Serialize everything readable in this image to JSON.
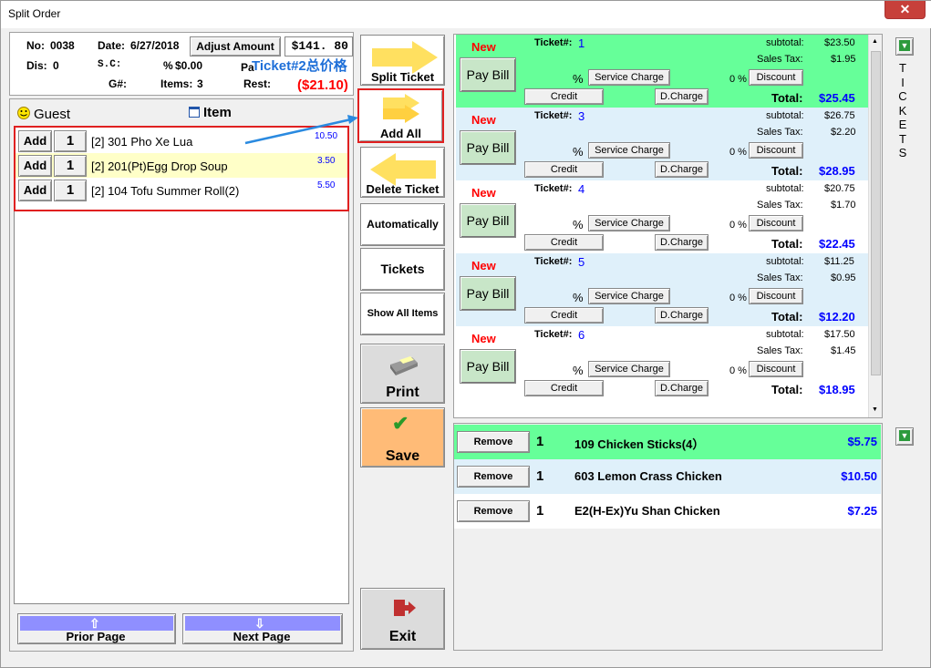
{
  "window": {
    "title": "Split Order",
    "close": "✕"
  },
  "order": {
    "no_label": "No:",
    "no": "0038",
    "date_label": "Date:",
    "date": "6/27/2018",
    "adjust_label": "Adjust Amount",
    "amount": "$141. 80",
    "dis_label": "Dis:",
    "dis": "0",
    "sc_label": "S.C:",
    "pct_label": "%",
    "sc_value": "$0.00",
    "paid_label": "Pa",
    "g_label": "G#:",
    "items_label": "Items:",
    "items": "3",
    "rest_label": "Rest:",
    "rest": "($21.10)"
  },
  "annotation": {
    "text": "Ticket#2总价格"
  },
  "tabs": {
    "guest": "Guest",
    "item": "Item"
  },
  "guest_items": [
    {
      "add": "Add",
      "qty": "1",
      "name": "[2] 301 Pho Xe Lua",
      "price": "10.50",
      "bg": "#ffffff"
    },
    {
      "add": "Add",
      "qty": "1",
      "name": "[2] 201(Pt)Egg Drop Soup",
      "price": "3.50",
      "bg": "#ffffc8"
    },
    {
      "add": "Add",
      "qty": "1",
      "name": "[2] 104 Tofu Summer Roll(2)",
      "price": "5.50",
      "bg": "#ffffff"
    }
  ],
  "pager": {
    "prior": "Prior Page",
    "next": "Next Page"
  },
  "actions": {
    "split_ticket": "Split Ticket",
    "add_all": "Add All",
    "delete_ticket": "Delete Ticket",
    "automatically": "Automatically",
    "tickets": "Tickets",
    "show_all": "Show All Items",
    "print": "Print",
    "save": "Save",
    "exit": "Exit"
  },
  "ticket_labels": {
    "new": "New",
    "ticket": "Ticket#:",
    "subtotal": "subtotal:",
    "tax": "Sales Tax:",
    "pay_bill": "Pay Bill",
    "pct": "%",
    "service_charge": "Service Charge",
    "zero_pct": "0 %",
    "discount": "Discount",
    "credit": "Credit",
    "dcharge": "D.Charge",
    "total": "Total:"
  },
  "tickets": [
    {
      "num": "1",
      "subtotal": "$23.50",
      "tax": "$1.95",
      "total": "$25.45",
      "bg": "#66ff99"
    },
    {
      "num": "3",
      "subtotal": "$26.75",
      "tax": "$2.20",
      "total": "$28.95",
      "bg": "#dff0fa"
    },
    {
      "num": "4",
      "subtotal": "$20.75",
      "tax": "$1.70",
      "total": "$22.45",
      "bg": "#ffffff"
    },
    {
      "num": "5",
      "subtotal": "$11.25",
      "tax": "$0.95",
      "total": "$12.20",
      "bg": "#dff0fa"
    },
    {
      "num": "6",
      "subtotal": "$17.50",
      "tax": "$1.45",
      "total": "$18.95",
      "bg": "#ffffff"
    }
  ],
  "ticket_items": [
    {
      "remove": "Remove",
      "qty": "1",
      "name": "109 Chicken Sticks(4）",
      "price": "$5.75",
      "bg": "#66ff99"
    },
    {
      "remove": "Remove",
      "qty": "1",
      "name": "603 Lemon Crass Chicken",
      "price": "$10.50",
      "bg": "#dff0fa"
    },
    {
      "remove": "Remove",
      "qty": "1",
      "name": "E2(H-Ex)Yu Shan Chicken",
      "price": "$7.25",
      "bg": "#ffffff"
    }
  ],
  "side_label": [
    "T",
    "I",
    "C",
    "K",
    "E",
    "T",
    "S"
  ],
  "colors": {
    "green": "#66ff99",
    "light_blue": "#dff0fa",
    "yellow": "#ffffc8",
    "save_orange": "#ffbb77",
    "red_box": "#e02020",
    "pager_blue": "#8f8fff"
  }
}
